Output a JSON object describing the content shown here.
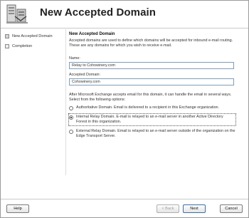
{
  "wizard": {
    "title": "New Accepted Domain",
    "logo_icon": "exchange-wizard-icon"
  },
  "nav": {
    "items": [
      {
        "label": "New Accepted Domain",
        "active": true
      },
      {
        "label": "Completion",
        "active": false
      }
    ]
  },
  "main": {
    "section_title": "New Accepted Domain",
    "description": "Accepted domains are used to define which domains will be accepted for inbound e-mail routing.  These are any domains for which you wish to receive e-mail.",
    "name_label": "Name:",
    "name_value": "Relay to Cohowinery.com",
    "domain_label": "Accepted Domain:",
    "domain_value": "Cohowinery.com",
    "after_text": "After Microsoft Exchange accepts email for this domain, it can handle the email in several ways.  Select from the following options:",
    "options": [
      {
        "label": "Authoritative Domain.  Email is delivered to a recipient in this Exchange organization.",
        "selected": false
      },
      {
        "label": "Internal Relay Domain.  E-mail is relayed to an e-mail server in another Active Directory Forest in this organization.",
        "selected": true
      },
      {
        "label": "External Relay Domain.  Email is relayed to an e-mail server outside of the organization on the Edge Transport Server.",
        "selected": false
      }
    ]
  },
  "footer": {
    "help": "Help",
    "back": "< Back",
    "next": "Next",
    "cancel": "Cancel"
  }
}
